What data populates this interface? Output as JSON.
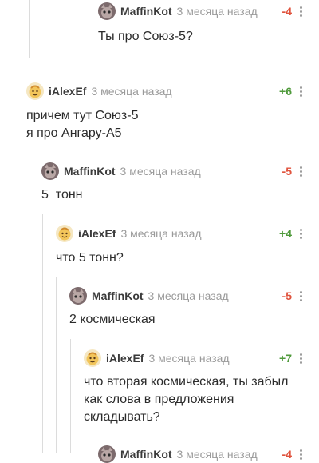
{
  "comments": [
    {
      "author": "MaffinKot",
      "time": "3 месяца назад",
      "rating": "-4",
      "lines": [
        "Ты про Союз-5?"
      ]
    },
    {
      "author": "iAlexEf",
      "time": "3 месяца назад",
      "rating": "+6",
      "lines": [
        "причем тут Союз-5",
        "я про Ангару-А5"
      ]
    },
    {
      "author": "MaffinKot",
      "time": "3 месяца назад",
      "rating": "-5",
      "lines": [
        "5  тонн"
      ]
    },
    {
      "author": "iAlexEf",
      "time": "3 месяца назад",
      "rating": "+4",
      "lines": [
        "что 5 тонн?"
      ]
    },
    {
      "author": "MaffinKot",
      "time": "3 месяца назад",
      "rating": "-5",
      "lines": [
        "2 космическая"
      ]
    },
    {
      "author": "iAlexEf",
      "time": "3 месяца назад",
      "rating": "+7",
      "lines": [
        "что вторая космическая, ты забыл",
        "как слова в предложения",
        "складывать?"
      ]
    },
    {
      "author": "MaffinKot",
      "time": "3 месяца назад",
      "rating": "-4",
      "lines": []
    }
  ],
  "colors": {
    "positive": "#4f9a3b",
    "negative": "#e0533d",
    "muted": "#9a9a9a"
  },
  "icons": {
    "more": "more-vertical-icon",
    "cat_avatar": "cat-avatar-icon",
    "smiley_avatar": "smiley-avatar-icon"
  }
}
